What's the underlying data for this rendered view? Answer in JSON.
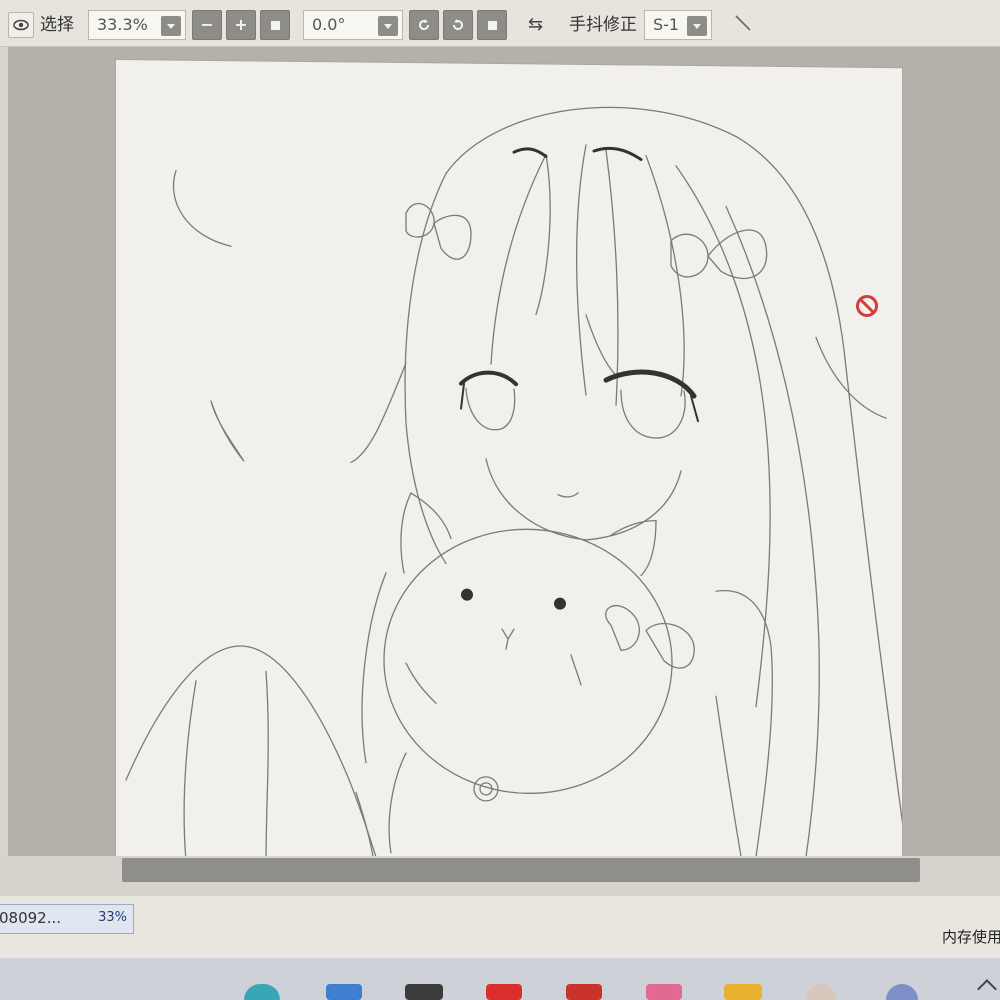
{
  "toolbar": {
    "select_label": "选择",
    "zoom_value": "33.3%",
    "zoom_out": "−",
    "zoom_in": "+",
    "rotation_value": "0.0°",
    "swap_icon": "⇆",
    "stabilizer_label": "手抖修正",
    "stabilizer_value": "S-1"
  },
  "status": {
    "doc_name": "08092...",
    "doc_zoom": "33%",
    "memory_label": "内存使用"
  },
  "colors": {
    "toolbar_bg": "#e6e4dc",
    "workspace_bg": "#b3b1a9",
    "canvas_bg": "#f1f0ec",
    "button_gray": "#8d8c87",
    "forbid_red": "#d43b3b"
  },
  "icons": [
    "eye-icon",
    "chevron-down-icon",
    "minus-icon",
    "plus-icon",
    "stop-icon",
    "rotate-left-icon",
    "rotate-right-icon",
    "swap-icon",
    "pen-icon",
    "no-entry-icon"
  ]
}
